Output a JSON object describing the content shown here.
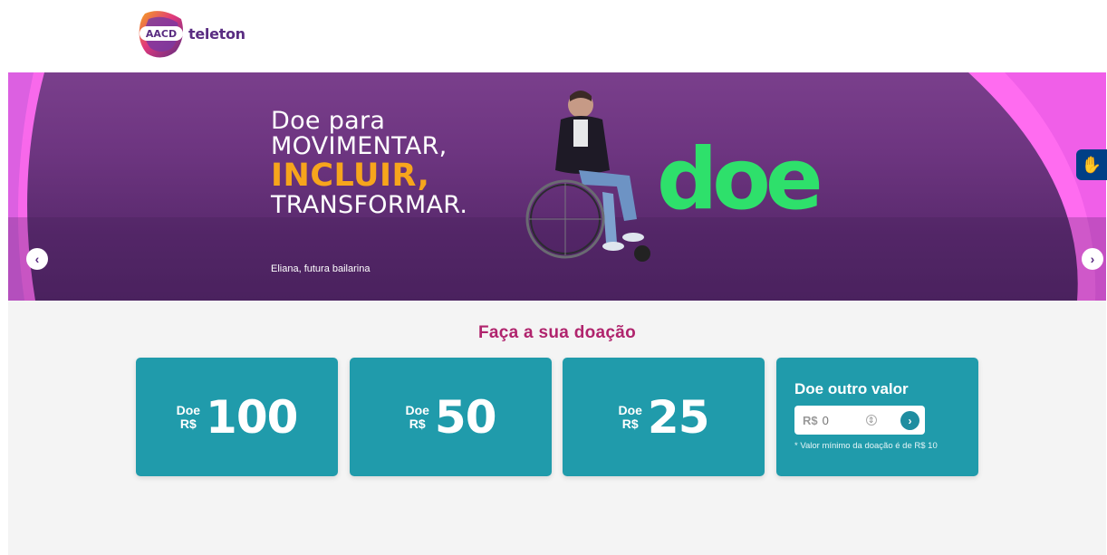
{
  "header": {
    "logo_badge": "AACD",
    "logo_text": "teleton"
  },
  "banner": {
    "line1": "Doe para",
    "line2": "MOVIMENTAR,",
    "line3": "INCLUIR,",
    "line4": "TRANSFORMAR.",
    "caption": "Eliana, futura bailarina",
    "big_word": "doe",
    "prev_icon": "‹",
    "next_icon": "›",
    "colors": {
      "accent_orange": "#f7a51c",
      "accent_green": "#2ee06b",
      "purple": "#6d3580",
      "pink": "#ff6cf0"
    }
  },
  "accessibility": {
    "icon": "sign-language-icon",
    "glyph": "✋"
  },
  "donation": {
    "title": "Faça a sua doação",
    "cards": [
      {
        "doe": "Doe",
        "currency": "R$",
        "value": "100"
      },
      {
        "doe": "Doe",
        "currency": "R$",
        "value": "50"
      },
      {
        "doe": "Doe",
        "currency": "R$",
        "value": "25"
      }
    ],
    "custom": {
      "title": "Doe outro valor",
      "currency": "R$",
      "placeholder": "0",
      "spin_icon": "⇕",
      "go_icon": "›",
      "note": "* Valor mínimo da doação é de R$ 10"
    },
    "colors": {
      "card": "#209bab",
      "title": "#b0246d"
    }
  }
}
